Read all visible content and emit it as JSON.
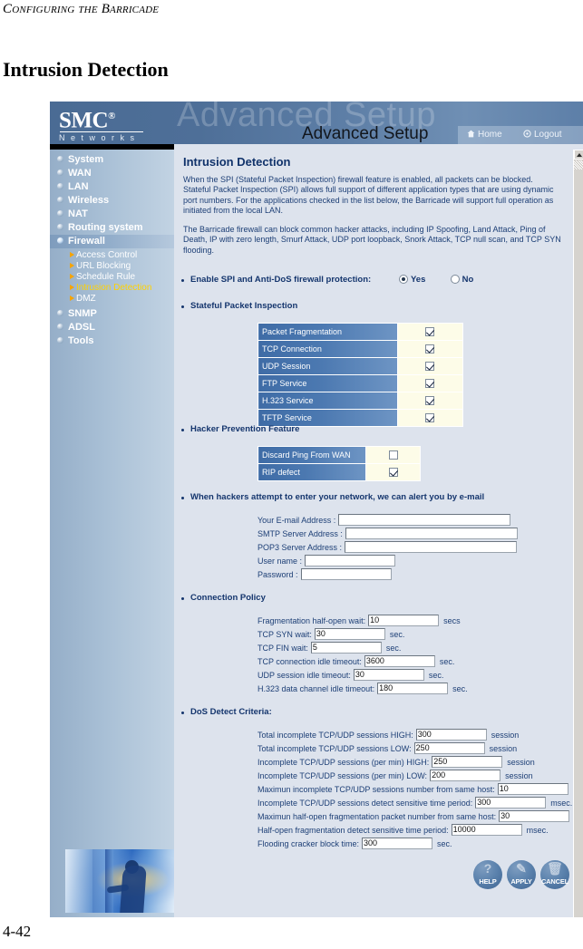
{
  "manual": {
    "running_head": "Configuring the Barricade",
    "heading": "Intrusion Detection",
    "folio": "4-42"
  },
  "header": {
    "brand": "SMC",
    "brand_reg": "®",
    "brand_sub": "N e t w o r k s",
    "ghost_title": "Advanced Setup",
    "title": "Advanced Setup",
    "home_label": "Home",
    "logout_label": "Logout"
  },
  "sidebar": {
    "items": [
      {
        "label": "System",
        "selected": false
      },
      {
        "label": "WAN",
        "selected": false
      },
      {
        "label": "LAN",
        "selected": false
      },
      {
        "label": "Wireless",
        "selected": false
      },
      {
        "label": "NAT",
        "selected": false
      },
      {
        "label": "Routing system",
        "selected": false
      },
      {
        "label": "Firewall",
        "selected": true
      },
      {
        "label": "SNMP",
        "selected": false
      },
      {
        "label": "ADSL",
        "selected": false
      },
      {
        "label": "Tools",
        "selected": false
      }
    ],
    "sub_items": [
      {
        "label": "Access Control",
        "active": false
      },
      {
        "label": "URL Blocking",
        "active": false
      },
      {
        "label": "Schedule Rule",
        "active": false
      },
      {
        "label": "Intrusion Detection",
        "active": true
      },
      {
        "label": "DMZ",
        "active": false
      }
    ]
  },
  "main": {
    "title": "Intrusion Detection",
    "paragraph1": "When the SPI (Stateful Packet Inspection) firewall feature is enabled, all packets can be blocked.  Stateful Packet Inspection (SPI) allows full support of different application types that are using dynamic port numbers.  For the applications checked in the list below, the Barricade will support full operation as initiated from the local LAN.",
    "paragraph2": "The Barricade firewall can block common hacker attacks, including IP Spoofing, Land Attack, Ping of Death, IP with zero length, Smurf Attack, UDP port loopback, Snork Attack, TCP null scan, and TCP SYN flooding.",
    "spi_enable": {
      "label": "Enable SPI and Anti-DoS firewall protection:",
      "yes_label": "Yes",
      "no_label": "No",
      "value": "Yes"
    },
    "spi_section_label": "Stateful Packet Inspection",
    "spi_rows": [
      {
        "label": "Packet Fragmentation",
        "checked": true
      },
      {
        "label": "TCP Connection",
        "checked": true
      },
      {
        "label": "UDP Session",
        "checked": true
      },
      {
        "label": "FTP Service",
        "checked": true
      },
      {
        "label": "H.323 Service",
        "checked": true
      },
      {
        "label": "TFTP  Service",
        "checked": true
      }
    ],
    "hacker_section_label": "Hacker Prevention Feature",
    "hacker_rows": [
      {
        "label": "Discard Ping From WAN",
        "checked": false
      },
      {
        "label": "RIP defect",
        "checked": true
      }
    ],
    "email_section_label": "When hackers attempt to enter your network, we can alert you by e-mail",
    "email_fields": [
      {
        "label": "Your E-mail Address :",
        "value": ""
      },
      {
        "label": "SMTP Server Address :",
        "value": ""
      },
      {
        "label": "POP3 Server Address :",
        "value": ""
      },
      {
        "label": "User name :",
        "value": ""
      },
      {
        "label": "Password :",
        "value": ""
      }
    ],
    "connection_policy_label": "Connection Policy",
    "connection_policy": [
      {
        "label": "Fragmentation half-open wait:",
        "value": "10",
        "unit": "secs"
      },
      {
        "label": "TCP SYN wait:",
        "value": "30",
        "unit": "sec."
      },
      {
        "label": "TCP FIN wait:",
        "value": "5",
        "unit": "sec."
      },
      {
        "label": "TCP connection idle timeout:",
        "value": "3600",
        "unit": "sec."
      },
      {
        "label": "UDP session idle timeout:",
        "value": "30",
        "unit": "sec."
      },
      {
        "label": "H.323 data channel idle timeout:",
        "value": "180",
        "unit": "sec."
      }
    ],
    "dos_label": "DoS Detect Criteria:",
    "dos_criteria": [
      {
        "label": "Total incomplete TCP/UDP sessions HIGH:",
        "value": "300",
        "unit": "session"
      },
      {
        "label": "Total incomplete TCP/UDP sessions LOW:",
        "value": "250",
        "unit": "session"
      },
      {
        "label": "Incomplete TCP/UDP sessions (per min) HIGH:",
        "value": "250",
        "unit": "session"
      },
      {
        "label": "Incomplete TCP/UDP sessions (per min) LOW:",
        "value": "200",
        "unit": "session"
      },
      {
        "label": "Maximun incomplete TCP/UDP sessions number from same host:",
        "value": "10",
        "unit": ""
      },
      {
        "label": "Incomplete TCP/UDP sessions detect sensitive time period:",
        "value": "300",
        "unit": "msec."
      },
      {
        "label": "Maximun half-open fragmentation packet number from same host:",
        "value": "30",
        "unit": ""
      },
      {
        "label": "Half-open fragmentation detect sensitive time period:",
        "value": "10000",
        "unit": "msec."
      },
      {
        "label": "Flooding cracker block time:",
        "value": "300",
        "unit": "sec."
      }
    ],
    "buttons": [
      {
        "label": "HELP",
        "glyph": "?"
      },
      {
        "label": "APPLY",
        "glyph": "✎"
      },
      {
        "label": "CANCEL",
        "glyph": "🗑"
      }
    ]
  },
  "colors": {
    "header_blue": "#4e6f98",
    "pane_bg": "#dde3ed",
    "row_label_blue": "#4c79b1",
    "row_cell_cream": "#fdfce8",
    "text_blue": "#1d3f76",
    "active_link": "#ffd200"
  }
}
